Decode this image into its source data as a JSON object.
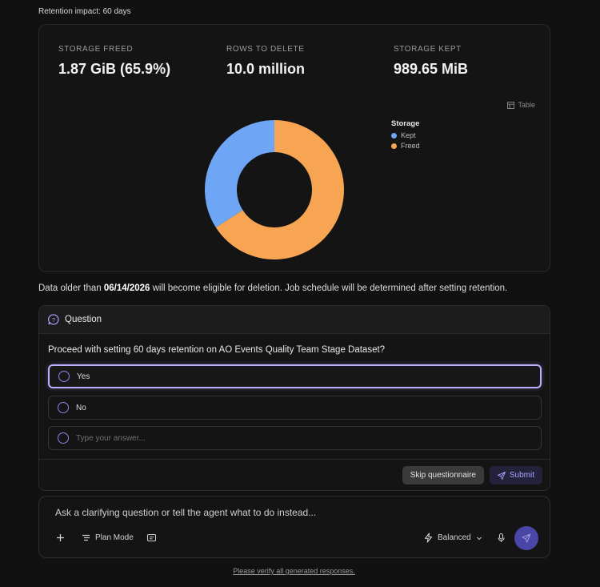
{
  "caption": "Retention impact: 60 days",
  "stats": [
    {
      "label": "STORAGE FREED",
      "value": "1.87 GiB (65.9%)"
    },
    {
      "label": "ROWS TO DELETE",
      "value": "10.0 million"
    },
    {
      "label": "STORAGE KEPT",
      "value": "989.65 MiB"
    }
  ],
  "table_toggle": "Table",
  "chart_data": {
    "type": "pie",
    "donut": true,
    "legend_title": "Storage",
    "legend_position": "right",
    "categories": [
      "Kept",
      "Freed"
    ],
    "values": [
      34.1,
      65.9
    ],
    "colors": [
      "#6ea6f5",
      "#f7a553"
    ]
  },
  "info": {
    "prefix": "Data older than ",
    "date": "06/14/2026",
    "suffix": " will become eligible for deletion. Job schedule will be determined after setting retention."
  },
  "question": {
    "header": "Question",
    "text": "Proceed with setting 60 days retention on AO Events Quality Team Stage Dataset?",
    "options": [
      {
        "label": "Yes",
        "selected": true
      },
      {
        "label": "No",
        "selected": false
      }
    ],
    "answer_placeholder": "Type your answer...",
    "skip_label": "Skip questionnaire",
    "submit_label": "Submit"
  },
  "composer": {
    "placeholder": "Ask a clarifying question or tell the agent what to do instead...",
    "plan_mode_label": "Plan Mode",
    "model_label": "Balanced"
  },
  "footer_link": "Please verify all generated responses.",
  "colors": {
    "accent": "#a9a2ff",
    "kept": "#6ea6f5",
    "freed": "#f7a553"
  }
}
